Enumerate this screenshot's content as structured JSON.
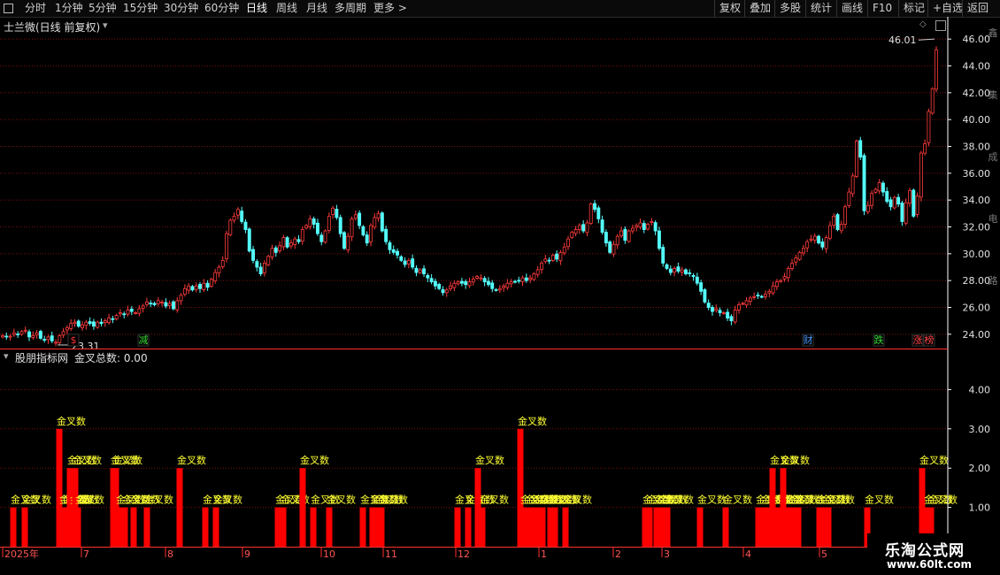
{
  "toolbar": {
    "periods": [
      "分时",
      "1分钟",
      "5分钟",
      "15分钟",
      "30分钟",
      "60分钟",
      "日线",
      "周线",
      "月线",
      "多周期",
      "更多 >"
    ],
    "active_index": 6,
    "right_buttons": [
      "复权",
      "叠加",
      "多股",
      "统计",
      "画线",
      "F10",
      "标记",
      "+自选",
      "返回"
    ]
  },
  "main": {
    "title": "士兰微(日线 前复权)",
    "high_label": "46.01",
    "low_label": "23.31",
    "y_axis": {
      "min": 23,
      "max": 47,
      "ticks": [
        "24.00",
        "26.00",
        "28.00",
        "30.00",
        "32.00",
        "34.00",
        "36.00",
        "38.00",
        "40.00",
        "42.00",
        "44.00",
        "46.00"
      ]
    },
    "events": [
      {
        "text": "$",
        "color": "#ff3333"
      },
      {
        "text": "减",
        "color": "#33dd33"
      },
      {
        "text": "财",
        "color": "#4499ff"
      },
      {
        "text": "跌",
        "color": "#33dd33"
      },
      {
        "text": "涨",
        "color": "#ff4444"
      },
      {
        "text": "榜",
        "color": "#ff4444"
      }
    ],
    "right_side_text": "鑫集成电路"
  },
  "indicator": {
    "name": "股朋指标网",
    "value_label": "金叉总数: 0.00",
    "bar_label": "金叉数",
    "y_ticks": [
      "1.00",
      "2.00",
      "3.00",
      "4.00"
    ],
    "y_max": 5
  },
  "x_axis": {
    "labels": [
      "2025年",
      "7",
      "8",
      "9",
      "10",
      "11",
      "12",
      "1",
      "2",
      "3",
      "4",
      "5"
    ]
  },
  "watermark": {
    "title": "乐淘公式网",
    "url": "www.60lt.com"
  },
  "colors": {
    "up": "#ff3b3b",
    "down": "#54ffff",
    "grid": "#7a1010",
    "axis": "#ffffff",
    "bar": "#ff0000",
    "bar_label": "#ffff33"
  },
  "chart_data": {
    "type": "candlestick",
    "closes": [
      23.9,
      23.8,
      23.85,
      24.1,
      24.0,
      24.2,
      24.3,
      23.8,
      23.9,
      24.1,
      23.7,
      23.6,
      23.8,
      23.5,
      23.4,
      23.9,
      24.2,
      24.5,
      24.8,
      24.9,
      24.6,
      24.7,
      24.9,
      24.8,
      24.6,
      24.9,
      24.8,
      25.0,
      25.2,
      25.1,
      25.4,
      25.6,
      25.5,
      25.8,
      25.7,
      25.6,
      25.9,
      26.1,
      26.4,
      26.3,
      26.2,
      26.5,
      26.4,
      26.1,
      26.3,
      25.9,
      26.5,
      26.9,
      27.4,
      27.6,
      27.3,
      27.6,
      27.4,
      27.8,
      27.5,
      28.1,
      28.6,
      29.0,
      29.5,
      31.5,
      32.5,
      32.8,
      33.3,
      32.4,
      31.8,
      30.2,
      29.5,
      29.0,
      28.5,
      29.3,
      29.8,
      30.4,
      30.1,
      30.6,
      31.2,
      30.5,
      30.8,
      31.1,
      30.9,
      31.8,
      32.1,
      32.6,
      32.2,
      31.5,
      30.9,
      31.7,
      32.8,
      33.4,
      32.7,
      31.5,
      30.4,
      31.3,
      32.6,
      32.9,
      32.1,
      31.4,
      30.8,
      32.1,
      32.7,
      33.0,
      31.7,
      30.9,
      30.3,
      30.1,
      29.9,
      29.5,
      29.2,
      29.5,
      29.0,
      28.6,
      28.8,
      28.5,
      28.2,
      27.9,
      27.6,
      27.4,
      27.1,
      27.3,
      27.6,
      27.8,
      27.9,
      27.8,
      27.7,
      27.9,
      28.1,
      28.3,
      28.2,
      27.9,
      27.7,
      27.4,
      27.3,
      27.4,
      27.6,
      27.8,
      27.9,
      27.9,
      28.0,
      28.2,
      28.0,
      28.2,
      28.5,
      28.8,
      29.3,
      29.6,
      29.5,
      29.9,
      29.6,
      30.1,
      30.5,
      31.1,
      31.6,
      31.8,
      32.1,
      31.7,
      32.3,
      33.7,
      33.3,
      32.6,
      31.6,
      30.8,
      30.1,
      30.7,
      31.3,
      31.7,
      31.0,
      31.7,
      31.9,
      32.1,
      32.3,
      31.8,
      32.2,
      32.4,
      31.7,
      30.4,
      29.3,
      28.9,
      28.6,
      28.9,
      28.7,
      28.8,
      28.5,
      28.5,
      28.3,
      27.8,
      27.2,
      26.4,
      26.0,
      25.7,
      25.9,
      25.6,
      25.6,
      25.2,
      25.0,
      25.8,
      26.2,
      26.3,
      26.5,
      26.7,
      26.8,
      26.9,
      26.8,
      27.0,
      27.2,
      27.6,
      27.9,
      28.0,
      28.3,
      28.9,
      29.3,
      29.7,
      30.1,
      30.4,
      30.9,
      31.1,
      31.3,
      30.8,
      30.5,
      31.2,
      32.1,
      32.8,
      31.8,
      32.2,
      33.5,
      34.6,
      35.8,
      38.4,
      37.2,
      33.2,
      33.6,
      34.5,
      34.8,
      35.3,
      34.6,
      33.9,
      33.5,
      34.2,
      33.7,
      32.4,
      33.8,
      34.7,
      32.8,
      34.3,
      37.5,
      38.2,
      40.6,
      42.3,
      45.2
    ],
    "events_at": [
      83,
      162,
      913,
      993,
      1037,
      1050
    ],
    "indicator_values": [
      [
        15,
        1
      ],
      [
        28,
        1
      ],
      [
        67,
        3
      ],
      [
        70,
        1
      ],
      [
        73,
        1
      ],
      [
        76,
        1
      ],
      [
        79,
        2
      ],
      [
        82,
        1
      ],
      [
        85,
        2
      ],
      [
        88,
        1
      ],
      [
        128,
        2
      ],
      [
        131,
        2
      ],
      [
        134,
        1
      ],
      [
        141,
        1
      ],
      [
        151,
        1
      ],
      [
        166,
        1
      ],
      [
        203,
        2
      ],
      [
        232,
        1
      ],
      [
        244,
        1
      ],
      [
        314,
        1
      ],
      [
        320,
        1
      ],
      [
        342,
        2
      ],
      [
        354,
        1
      ],
      [
        372,
        1
      ],
      [
        410,
        1
      ],
      [
        421,
        1
      ],
      [
        426,
        1
      ],
      [
        431,
        1
      ],
      [
        517,
        1
      ],
      [
        529,
        1
      ],
      [
        540,
        2
      ],
      [
        545,
        1
      ],
      [
        588,
        3
      ],
      [
        591,
        1
      ],
      [
        596,
        1
      ],
      [
        601,
        1
      ],
      [
        606,
        1
      ],
      [
        613,
        1
      ],
      [
        622,
        1
      ],
      [
        627,
        1
      ],
      [
        639,
        1
      ],
      [
        729,
        1
      ],
      [
        734,
        1
      ],
      [
        742,
        1
      ],
      [
        747,
        1
      ],
      [
        754,
        1
      ],
      [
        791,
        1
      ],
      [
        820,
        1
      ],
      [
        857,
        1
      ],
      [
        863,
        1
      ],
      [
        868,
        1
      ],
      [
        873,
        2
      ],
      [
        878,
        1
      ],
      [
        885,
        2
      ],
      [
        890,
        1
      ],
      [
        895,
        1
      ],
      [
        902,
        1
      ],
      [
        926,
        1
      ],
      [
        931,
        1
      ],
      [
        936,
        1
      ],
      [
        980,
        1
      ],
      [
        1042,
        2
      ],
      [
        1047,
        1
      ],
      [
        1052,
        1
      ]
    ]
  }
}
